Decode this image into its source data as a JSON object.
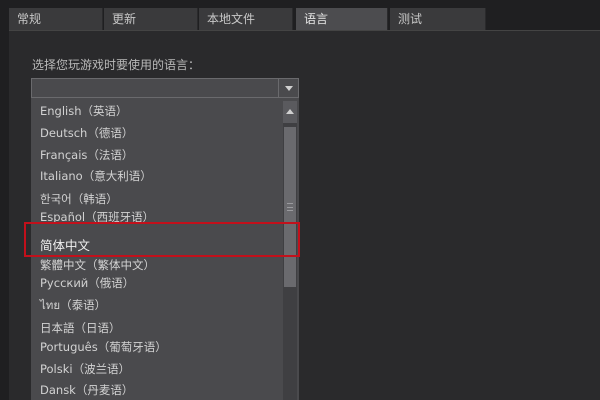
{
  "tabs": [
    {
      "label": "常规",
      "active": false
    },
    {
      "label": "更新",
      "active": false
    },
    {
      "label": "本地文件",
      "active": false
    },
    {
      "label": "语言",
      "active": true
    },
    {
      "label": "测试",
      "active": false
    }
  ],
  "language_section": {
    "prompt": "选择您玩游戏时要使用的语言：",
    "selected_value": "",
    "options": [
      {
        "label": "English（英语）"
      },
      {
        "label": "Deutsch（德语）"
      },
      {
        "label": "Français（法语）"
      },
      {
        "label": "Italiano（意大利语）"
      },
      {
        "label": "한국어（韩语）"
      },
      {
        "label": "Español（西班牙语）"
      },
      {
        "label": "简体中文",
        "highlighted": true
      },
      {
        "label": "繁體中文（繁体中文）"
      },
      {
        "label": "Русский（俄语）"
      },
      {
        "label": "ไทย（泰语）"
      },
      {
        "label": "日本語（日语）"
      },
      {
        "label": "Português（葡萄牙语）"
      },
      {
        "label": "Polski（波兰语）"
      },
      {
        "label": "Dansk（丹麦语）"
      }
    ]
  },
  "colors": {
    "highlight_border": "#c2101b",
    "background": "#1f1f21",
    "panel": "#2a2a2c",
    "list_background": "#4a4a4d",
    "active_tab": "#4c4c4f"
  },
  "icons": {
    "dropdown": "chevron-down-icon",
    "scroll_up": "chevron-up-icon",
    "scroll_grip": "grip-icon"
  }
}
